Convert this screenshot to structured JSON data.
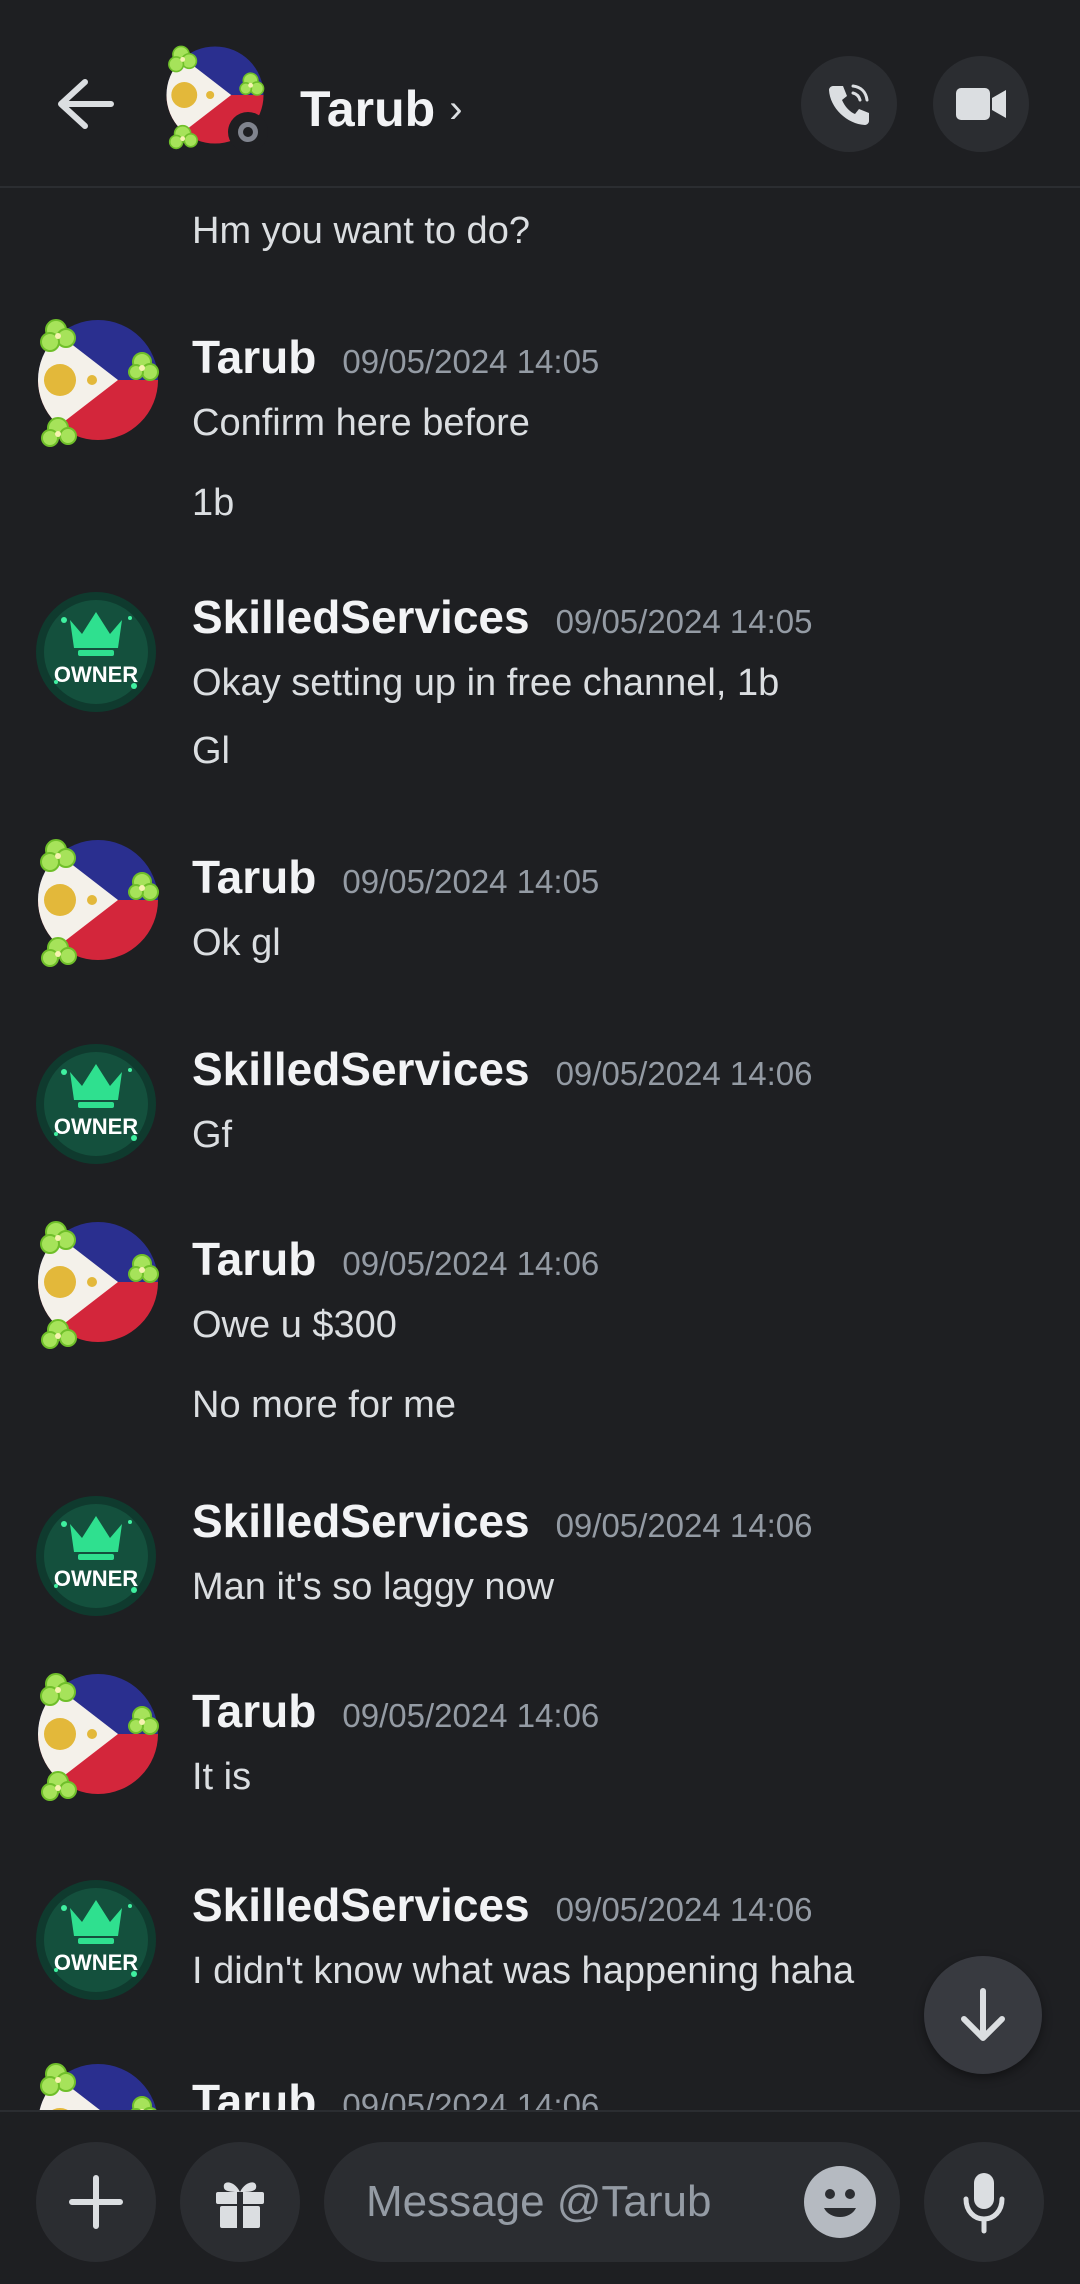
{
  "header": {
    "title": "Tarub",
    "chevron": "›",
    "back_icon": "arrow-left-icon",
    "call_icon": "phone-icon",
    "video_icon": "video-camera-icon"
  },
  "messages": [
    {
      "type": "continuation",
      "text": "Hm you want to do?"
    },
    {
      "type": "group",
      "author": "Tarub",
      "time": "09/05/2024 14:05",
      "lines": [
        "Confirm here before",
        "1b"
      ]
    },
    {
      "type": "group",
      "author": "SkilledServices",
      "time": "09/05/2024 14:05",
      "lines": [
        "Okay setting up in free channel, 1b",
        "Gl"
      ]
    },
    {
      "type": "group",
      "author": "Tarub",
      "time": "09/05/2024 14:05",
      "lines": [
        "Ok gl"
      ]
    },
    {
      "type": "group",
      "author": "SkilledServices",
      "time": "09/05/2024 14:06",
      "lines": [
        "Gf"
      ]
    },
    {
      "type": "group",
      "author": "Tarub",
      "time": "09/05/2024 14:06",
      "lines": [
        "Owe u $300",
        "No more for me"
      ]
    },
    {
      "type": "group",
      "author": "SkilledServices",
      "time": "09/05/2024 14:06",
      "lines": [
        "Man it's so laggy now"
      ]
    },
    {
      "type": "group",
      "author": "Tarub",
      "time": "09/05/2024 14:06",
      "lines": [
        "It is"
      ]
    },
    {
      "type": "group",
      "author": "SkilledServices",
      "time": "09/05/2024 14:06",
      "lines": [
        "I didn't know what was happening haha"
      ]
    },
    {
      "type": "group",
      "author": "Tarub",
      "time": "09/05/2024 14:06",
      "lines": []
    }
  ],
  "owner_badge": "OWNER",
  "composer": {
    "placeholder": "Message @Tarub",
    "value": ""
  },
  "colors": {
    "background": "#1e1f22",
    "surface": "#2b2d31",
    "text": "#dbdee1",
    "muted": "#949ba4",
    "owner_green": "#2fe08f"
  }
}
